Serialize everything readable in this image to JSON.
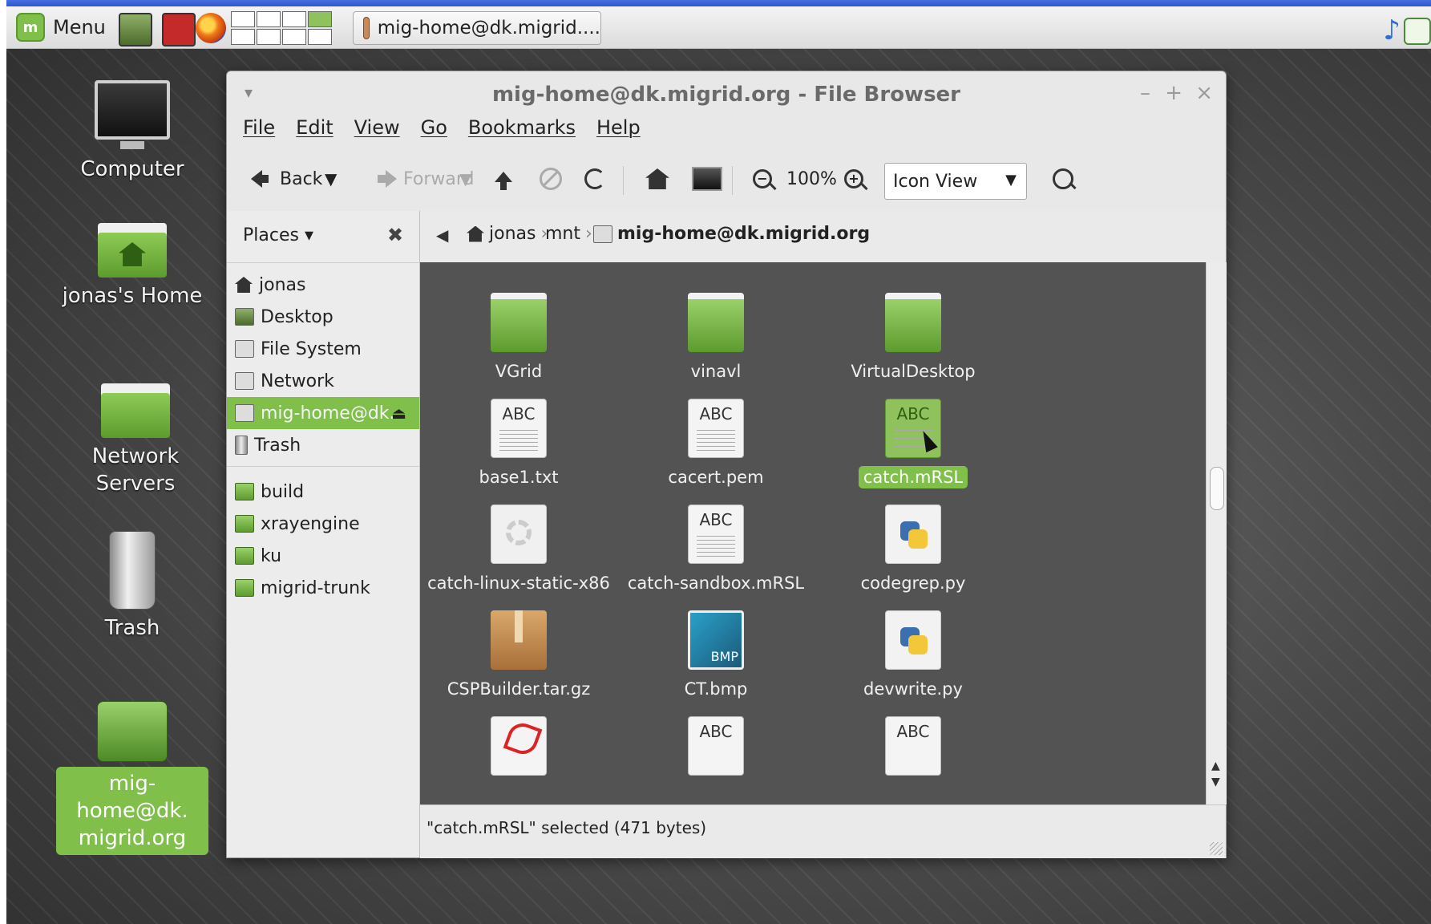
{
  "taskbar": {
    "menu_label": "Menu",
    "task_label": "mig-home@dk.migrid...."
  },
  "desktop": {
    "icons": [
      {
        "label": "Computer"
      },
      {
        "label": "jonas's Home"
      },
      {
        "label": "Network Servers"
      },
      {
        "label": "Trash"
      },
      {
        "label": "mig-home@dk.\nmigrid.org"
      }
    ]
  },
  "window": {
    "title": "mig-home@dk.migrid.org - File Browser",
    "menus": [
      "File",
      "Edit",
      "View",
      "Go",
      "Bookmarks",
      "Help"
    ],
    "toolbar": {
      "back_label": "Back",
      "forward_label": "Forward",
      "zoom_level": "100%",
      "view_mode": "Icon View"
    },
    "places": {
      "header": "Places",
      "items": [
        "jonas",
        "Desktop",
        "File System",
        "Network",
        "mig-home@dk...",
        "Trash"
      ],
      "bookmarks": [
        "build",
        "xrayengine",
        "ku",
        "migrid-trunk"
      ]
    },
    "path": {
      "segments": [
        "jonas",
        "mnt",
        "mig-home@dk.migrid.org"
      ]
    },
    "files": [
      {
        "name": "VGrid",
        "type": "folder"
      },
      {
        "name": "vinavl",
        "type": "folder"
      },
      {
        "name": "VirtualDesktop",
        "type": "folder"
      },
      {
        "name": "base1.txt",
        "type": "text",
        "icon_text": "ABC"
      },
      {
        "name": "cacert.pem",
        "type": "text",
        "icon_text": "ABC"
      },
      {
        "name": "catch.mRSL",
        "type": "text",
        "icon_text": "ABC",
        "selected": true
      },
      {
        "name": "catch-linux-static-x86",
        "type": "executable"
      },
      {
        "name": "catch-sandbox.mRSL",
        "type": "text",
        "icon_text": "ABC"
      },
      {
        "name": "codegrep.py",
        "type": "python"
      },
      {
        "name": "CSPBuilder.tar.gz",
        "type": "archive"
      },
      {
        "name": "CT.bmp",
        "type": "image",
        "icon_text": "BMP"
      },
      {
        "name": "devwrite.py",
        "type": "python"
      }
    ],
    "partial_icons": [
      "ABC",
      "ABC"
    ],
    "status": "\"catch.mRSL\" selected (471 bytes)"
  },
  "colors": {
    "accent_green": "#7fbf4a",
    "icon_area_bg": "#535353",
    "taskbar_blue": "#2d55d6"
  }
}
